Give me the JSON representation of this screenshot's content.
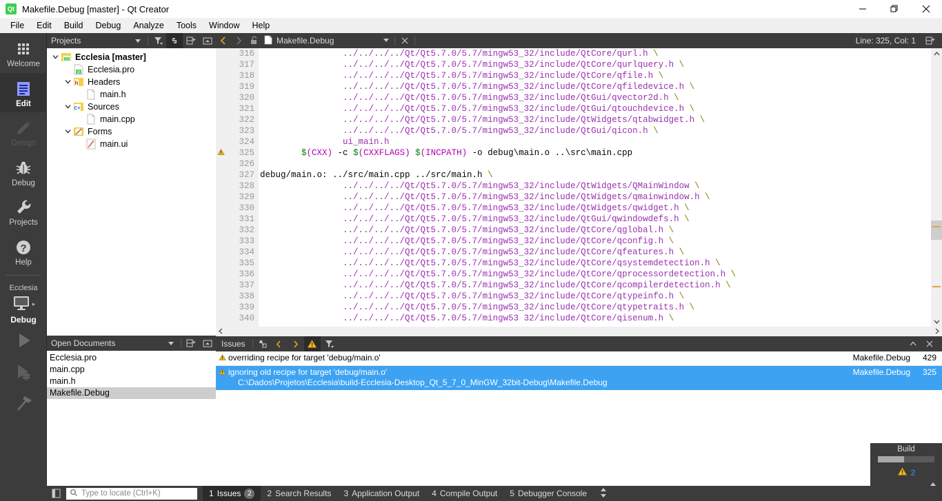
{
  "window": {
    "title": "Makefile.Debug [master] - Qt Creator",
    "logo_text": "Qt",
    "minimize_label": "Minimize",
    "restore_label": "Restore",
    "close_label": "Close"
  },
  "menubar": {
    "items": [
      "File",
      "Edit",
      "Build",
      "Debug",
      "Analyze",
      "Tools",
      "Window",
      "Help"
    ]
  },
  "modebar": {
    "modes": [
      {
        "label": "Welcome",
        "icon": "grid-icon",
        "state": "normal"
      },
      {
        "label": "Edit",
        "icon": "document-lines-icon",
        "state": "active"
      },
      {
        "label": "Design",
        "icon": "pencil-icon",
        "state": "disabled"
      },
      {
        "label": "Debug",
        "icon": "bug-icon",
        "state": "normal"
      },
      {
        "label": "Projects",
        "icon": "wrench-icon",
        "state": "normal"
      },
      {
        "label": "Help",
        "icon": "question-circle-icon",
        "state": "normal"
      }
    ],
    "kit": {
      "project": "Ecclesia",
      "target_icon": "desktop-monitor-icon",
      "build_config": "Debug",
      "arrow": "▸"
    },
    "run_buttons": [
      {
        "name": "run-button",
        "icon": "play-triangle-icon"
      },
      {
        "name": "start-debugging-button",
        "icon": "play-bug-icon"
      },
      {
        "name": "build-project-button",
        "icon": "hammer-icon"
      }
    ]
  },
  "projects_dock": {
    "title": "Projects",
    "buttons": [
      {
        "name": "filter-tree-button",
        "icon": "filter-icon",
        "on": false
      },
      {
        "name": "synchronize-with-editor-button",
        "icon": "link-icon",
        "on": true
      },
      {
        "name": "split-button",
        "icon": "split-add-icon",
        "on": false
      },
      {
        "name": "close-dock-button",
        "icon": "collapse-icon",
        "on": false
      }
    ],
    "tree": [
      {
        "label": "Ecclesia [master]",
        "indent": 0,
        "arrow": "⌄",
        "icon": "qt-project-icon",
        "bold": true
      },
      {
        "label": "Ecclesia.pro",
        "indent": 1,
        "arrow": "",
        "icon": "qt-pro-file-icon",
        "bold": false
      },
      {
        "label": "Headers",
        "indent": 1,
        "arrow": "⌄",
        "icon": "headers-folder-icon",
        "bold": false
      },
      {
        "label": "main.h",
        "indent": 2,
        "arrow": "",
        "icon": "file-icon",
        "bold": false
      },
      {
        "label": "Sources",
        "indent": 1,
        "arrow": "⌄",
        "icon": "sources-folder-icon",
        "bold": false
      },
      {
        "label": "main.cpp",
        "indent": 2,
        "arrow": "",
        "icon": "file-icon",
        "bold": false
      },
      {
        "label": "Forms",
        "indent": 1,
        "arrow": "⌄",
        "icon": "forms-folder-icon",
        "bold": false
      },
      {
        "label": "main.ui",
        "indent": 2,
        "arrow": "",
        "icon": "ui-form-icon",
        "bold": false
      }
    ]
  },
  "open_documents_dock": {
    "title": "Open Documents",
    "buttons": [
      {
        "name": "split-add-button",
        "icon": "split-add-icon"
      },
      {
        "name": "close-dock-button",
        "icon": "collapse-icon"
      }
    ],
    "items": [
      {
        "label": "Ecclesia.pro",
        "selected": false
      },
      {
        "label": "main.cpp",
        "selected": false
      },
      {
        "label": "main.h",
        "selected": false
      },
      {
        "label": "Makefile.Debug",
        "selected": true
      }
    ]
  },
  "editor_toolbar": {
    "back_icon": "chevron-left-icon",
    "forward_icon": "chevron-right-icon",
    "lock_icon": "unlocked-padlock-icon",
    "file_icon": "file-icon",
    "file_name": "Makefile.Debug",
    "dropdown_icon": "chevron-down-icon",
    "close_icon": "close-x-icon",
    "line_col": "Line: 325, Col: 1",
    "split_icon": "split-add-icon"
  },
  "editor": {
    "lines": [
      {
        "num": "316",
        "warn": false,
        "indent": 16,
        "segments": [
          {
            "t": "../../../../Qt/Qt5.7.0/5.7/mingw53_32/include/QtCore/qurl.h ",
            "c": "pp"
          },
          {
            "t": "\\",
            "c": "bslash"
          }
        ]
      },
      {
        "num": "317",
        "warn": false,
        "indent": 16,
        "segments": [
          {
            "t": "../../../../Qt/Qt5.7.0/5.7/mingw53_32/include/QtCore/qurlquery.h ",
            "c": "pp"
          },
          {
            "t": "\\",
            "c": "bslash"
          }
        ]
      },
      {
        "num": "318",
        "warn": false,
        "indent": 16,
        "segments": [
          {
            "t": "../../../../Qt/Qt5.7.0/5.7/mingw53_32/include/QtCore/qfile.h ",
            "c": "pp"
          },
          {
            "t": "\\",
            "c": "bslash"
          }
        ]
      },
      {
        "num": "319",
        "warn": false,
        "indent": 16,
        "segments": [
          {
            "t": "../../../../Qt/Qt5.7.0/5.7/mingw53_32/include/QtCore/qfiledevice.h ",
            "c": "pp"
          },
          {
            "t": "\\",
            "c": "bslash"
          }
        ]
      },
      {
        "num": "320",
        "warn": false,
        "indent": 16,
        "segments": [
          {
            "t": "../../../../Qt/Qt5.7.0/5.7/mingw53_32/include/QtGui/qvector2d.h ",
            "c": "pp"
          },
          {
            "t": "\\",
            "c": "bslash"
          }
        ]
      },
      {
        "num": "321",
        "warn": false,
        "indent": 16,
        "segments": [
          {
            "t": "../../../../Qt/Qt5.7.0/5.7/mingw53_32/include/QtGui/qtouchdevice.h ",
            "c": "pp"
          },
          {
            "t": "\\",
            "c": "bslash"
          }
        ]
      },
      {
        "num": "322",
        "warn": false,
        "indent": 16,
        "segments": [
          {
            "t": "../../../../Qt/Qt5.7.0/5.7/mingw53_32/include/QtWidgets/qtabwidget.h ",
            "c": "pp"
          },
          {
            "t": "\\",
            "c": "bslash"
          }
        ]
      },
      {
        "num": "323",
        "warn": false,
        "indent": 16,
        "segments": [
          {
            "t": "../../../../Qt/Qt5.7.0/5.7/mingw53_32/include/QtGui/qicon.h ",
            "c": "pp"
          },
          {
            "t": "\\",
            "c": "bslash"
          }
        ]
      },
      {
        "num": "324",
        "warn": false,
        "indent": 16,
        "segments": [
          {
            "t": "ui_main.h",
            "c": "pp"
          }
        ]
      },
      {
        "num": "325",
        "warn": true,
        "indent": 8,
        "segments": [
          {
            "t": "$",
            "c": "dollar"
          },
          {
            "t": "(CXX)",
            "c": "var"
          },
          {
            "t": " -c ",
            "c": "plain"
          },
          {
            "t": "$",
            "c": "dollar"
          },
          {
            "t": "(CXXFLAGS)",
            "c": "var"
          },
          {
            "t": " ",
            "c": "plain"
          },
          {
            "t": "$",
            "c": "dollar"
          },
          {
            "t": "(INCPATH)",
            "c": "var"
          },
          {
            "t": " -o debug\\main.o ..\\src\\main.cpp",
            "c": "plain"
          }
        ]
      },
      {
        "num": "326",
        "warn": false,
        "indent": 0,
        "segments": []
      },
      {
        "num": "327",
        "warn": false,
        "indent": 0,
        "segments": [
          {
            "t": "debug/main.o: ../src/main.cpp ../src/main.h ",
            "c": "plain"
          },
          {
            "t": "\\",
            "c": "bslash"
          }
        ]
      },
      {
        "num": "328",
        "warn": false,
        "indent": 16,
        "segments": [
          {
            "t": "../../../../Qt/Qt5.7.0/5.7/mingw53_32/include/QtWidgets/QMainWindow ",
            "c": "pp"
          },
          {
            "t": "\\",
            "c": "bslash"
          }
        ]
      },
      {
        "num": "329",
        "warn": false,
        "indent": 16,
        "segments": [
          {
            "t": "../../../../Qt/Qt5.7.0/5.7/mingw53_32/include/QtWidgets/qmainwindow.h ",
            "c": "pp"
          },
          {
            "t": "\\",
            "c": "bslash"
          }
        ]
      },
      {
        "num": "330",
        "warn": false,
        "indent": 16,
        "segments": [
          {
            "t": "../../../../Qt/Qt5.7.0/5.7/mingw53_32/include/QtWidgets/qwidget.h ",
            "c": "pp"
          },
          {
            "t": "\\",
            "c": "bslash"
          }
        ]
      },
      {
        "num": "331",
        "warn": false,
        "indent": 16,
        "segments": [
          {
            "t": "../../../../Qt/Qt5.7.0/5.7/mingw53_32/include/QtGui/qwindowdefs.h ",
            "c": "pp"
          },
          {
            "t": "\\",
            "c": "bslash"
          }
        ]
      },
      {
        "num": "332",
        "warn": false,
        "indent": 16,
        "segments": [
          {
            "t": "../../../../Qt/Qt5.7.0/5.7/mingw53_32/include/QtCore/qglobal.h ",
            "c": "pp"
          },
          {
            "t": "\\",
            "c": "bslash"
          }
        ]
      },
      {
        "num": "333",
        "warn": false,
        "indent": 16,
        "segments": [
          {
            "t": "../../../../Qt/Qt5.7.0/5.7/mingw53_32/include/QtCore/qconfig.h ",
            "c": "pp"
          },
          {
            "t": "\\",
            "c": "bslash"
          }
        ]
      },
      {
        "num": "334",
        "warn": false,
        "indent": 16,
        "segments": [
          {
            "t": "../../../../Qt/Qt5.7.0/5.7/mingw53_32/include/QtCore/qfeatures.h ",
            "c": "pp"
          },
          {
            "t": "\\",
            "c": "bslash"
          }
        ]
      },
      {
        "num": "335",
        "warn": false,
        "indent": 16,
        "segments": [
          {
            "t": "../../../../Qt/Qt5.7.0/5.7/mingw53_32/include/QtCore/qsystemdetection.h ",
            "c": "pp"
          },
          {
            "t": "\\",
            "c": "bslash"
          }
        ]
      },
      {
        "num": "336",
        "warn": false,
        "indent": 16,
        "segments": [
          {
            "t": "../../../../Qt/Qt5.7.0/5.7/mingw53_32/include/QtCore/qprocessordetection.h ",
            "c": "pp"
          },
          {
            "t": "\\",
            "c": "bslash"
          }
        ]
      },
      {
        "num": "337",
        "warn": false,
        "indent": 16,
        "segments": [
          {
            "t": "../../../../Qt/Qt5.7.0/5.7/mingw53_32/include/QtCore/qcompilerdetection.h ",
            "c": "pp"
          },
          {
            "t": "\\",
            "c": "bslash"
          }
        ]
      },
      {
        "num": "338",
        "warn": false,
        "indent": 16,
        "segments": [
          {
            "t": "../../../../Qt/Qt5.7.0/5.7/mingw53_32/include/QtCore/qtypeinfo.h ",
            "c": "pp"
          },
          {
            "t": "\\",
            "c": "bslash"
          }
        ]
      },
      {
        "num": "339",
        "warn": false,
        "indent": 16,
        "segments": [
          {
            "t": "../../../../Qt/Qt5.7.0/5.7/mingw53_32/include/QtCore/qtypetraits.h ",
            "c": "pp"
          },
          {
            "t": "\\",
            "c": "bslash"
          }
        ]
      },
      {
        "num": "340",
        "warn": false,
        "indent": 16,
        "segments": [
          {
            "t": "../../../../Qt/Qt5.7.0/5.7/mingw53 32/include/QtCore/qisenum.h ",
            "c": "pp"
          },
          {
            "t": "\\",
            "c": "bslash"
          }
        ]
      }
    ]
  },
  "issues_pane": {
    "title": "Issues",
    "buttons": [
      {
        "name": "clear-issues-button",
        "icon": "broom-icon",
        "on": false
      },
      {
        "name": "previous-issue-button",
        "icon": "chevron-left-icon",
        "on": false
      },
      {
        "name": "next-issue-button",
        "icon": "chevron-right-icon",
        "on": false
      },
      {
        "name": "filter-warnings-button",
        "icon": "warning-triangle-icon",
        "on": true
      },
      {
        "name": "filter-button",
        "icon": "filter-icon",
        "on": false
      }
    ],
    "collapse_icon": "chevron-up-icon",
    "close_icon": "close-x-icon",
    "rows": [
      {
        "severity": "warning",
        "description": "overriding recipe for target 'debug/main.o'",
        "detail": "",
        "file": "Makefile.Debug",
        "line": "429",
        "selected": false
      },
      {
        "severity": "warning",
        "description": "ignoring old recipe for target 'debug/main.o'",
        "detail": "C:\\Dados\\Projetos\\Ecclesia\\build-Ecclesia-Desktop_Qt_5_7_0_MinGW_32bit-Debug\\Makefile.Debug",
        "file": "Makefile.Debug",
        "line": "325",
        "selected": true
      }
    ]
  },
  "build_box": {
    "title": "Build",
    "progress_percent": 46,
    "warning_icon": "warning-triangle-icon",
    "warning_count": "2",
    "expand_icon": "chevron-up-icon"
  },
  "statusbar": {
    "toggle_sidebar_icon": "toggle-sidebar-icon",
    "locator": {
      "icon": "search-icon",
      "placeholder": "Type to locate (Ctrl+K)",
      "value": ""
    },
    "tabs": [
      {
        "number": "1",
        "label": "Issues",
        "badge": "2",
        "active": true
      },
      {
        "number": "2",
        "label": "Search Results",
        "badge": "",
        "active": false
      },
      {
        "number": "3",
        "label": "Application Output",
        "badge": "",
        "active": false
      },
      {
        "number": "4",
        "label": "Compile Output",
        "badge": "",
        "active": false
      },
      {
        "number": "5",
        "label": "Debugger Console",
        "badge": "",
        "active": false
      }
    ],
    "resize_icon": "up-down-arrows-icon"
  },
  "colors": {
    "accent_selection": "#3da2f2",
    "warning": "#f0b428",
    "qt_green": "#41cd52",
    "dark_chrome": "#3c3c3c",
    "preprocessor_purple": "#9b30b0",
    "makefile_var_purple": "#b000b0",
    "dollar_green": "#007f00",
    "backslash_olive": "#808000"
  }
}
